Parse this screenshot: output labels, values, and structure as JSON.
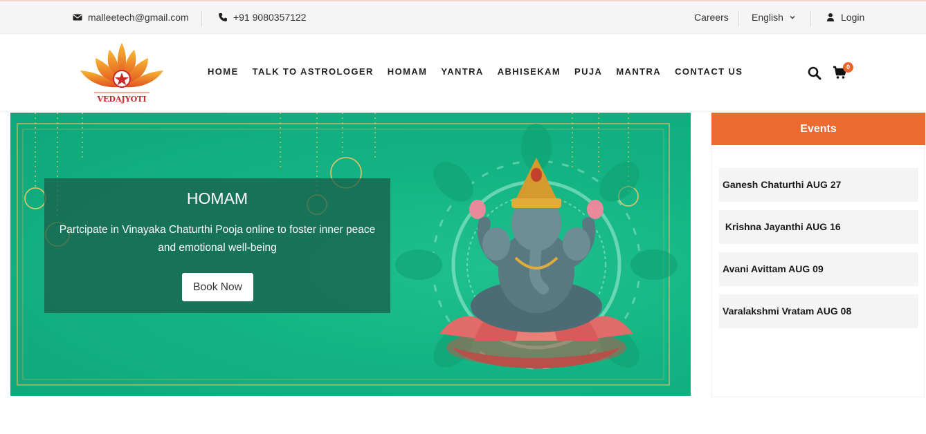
{
  "topbar": {
    "email": "malleetech@gmail.com",
    "phone": "+91 9080357122",
    "careers": "Careers",
    "language": "English",
    "login": "Login"
  },
  "header": {
    "logo_text": "VEDAJYOTI",
    "nav": [
      "HOME",
      "TALK TO ASTROLOGER",
      "HOMAM",
      "YANTRA",
      "ABHISEKAM",
      "PUJA",
      "MANTRA",
      "CONTACT US"
    ],
    "cart_count": "0"
  },
  "banner": {
    "title": "HOMAM",
    "text": "Partcipate in Vinayaka Chaturthi Pooja online to foster inner peace and emotional well-being",
    "button": "Book Now"
  },
  "events": {
    "heading": "Events",
    "items": [
      "Ganesh Chaturthi AUG 27",
      " Krishna Jayanthi AUG 16",
      "Avani Avittam AUG 09",
      "Varalakshmi Vratam AUG 08"
    ]
  },
  "colors": {
    "accent": "#ea6a30",
    "banner_green": "#14b383"
  }
}
